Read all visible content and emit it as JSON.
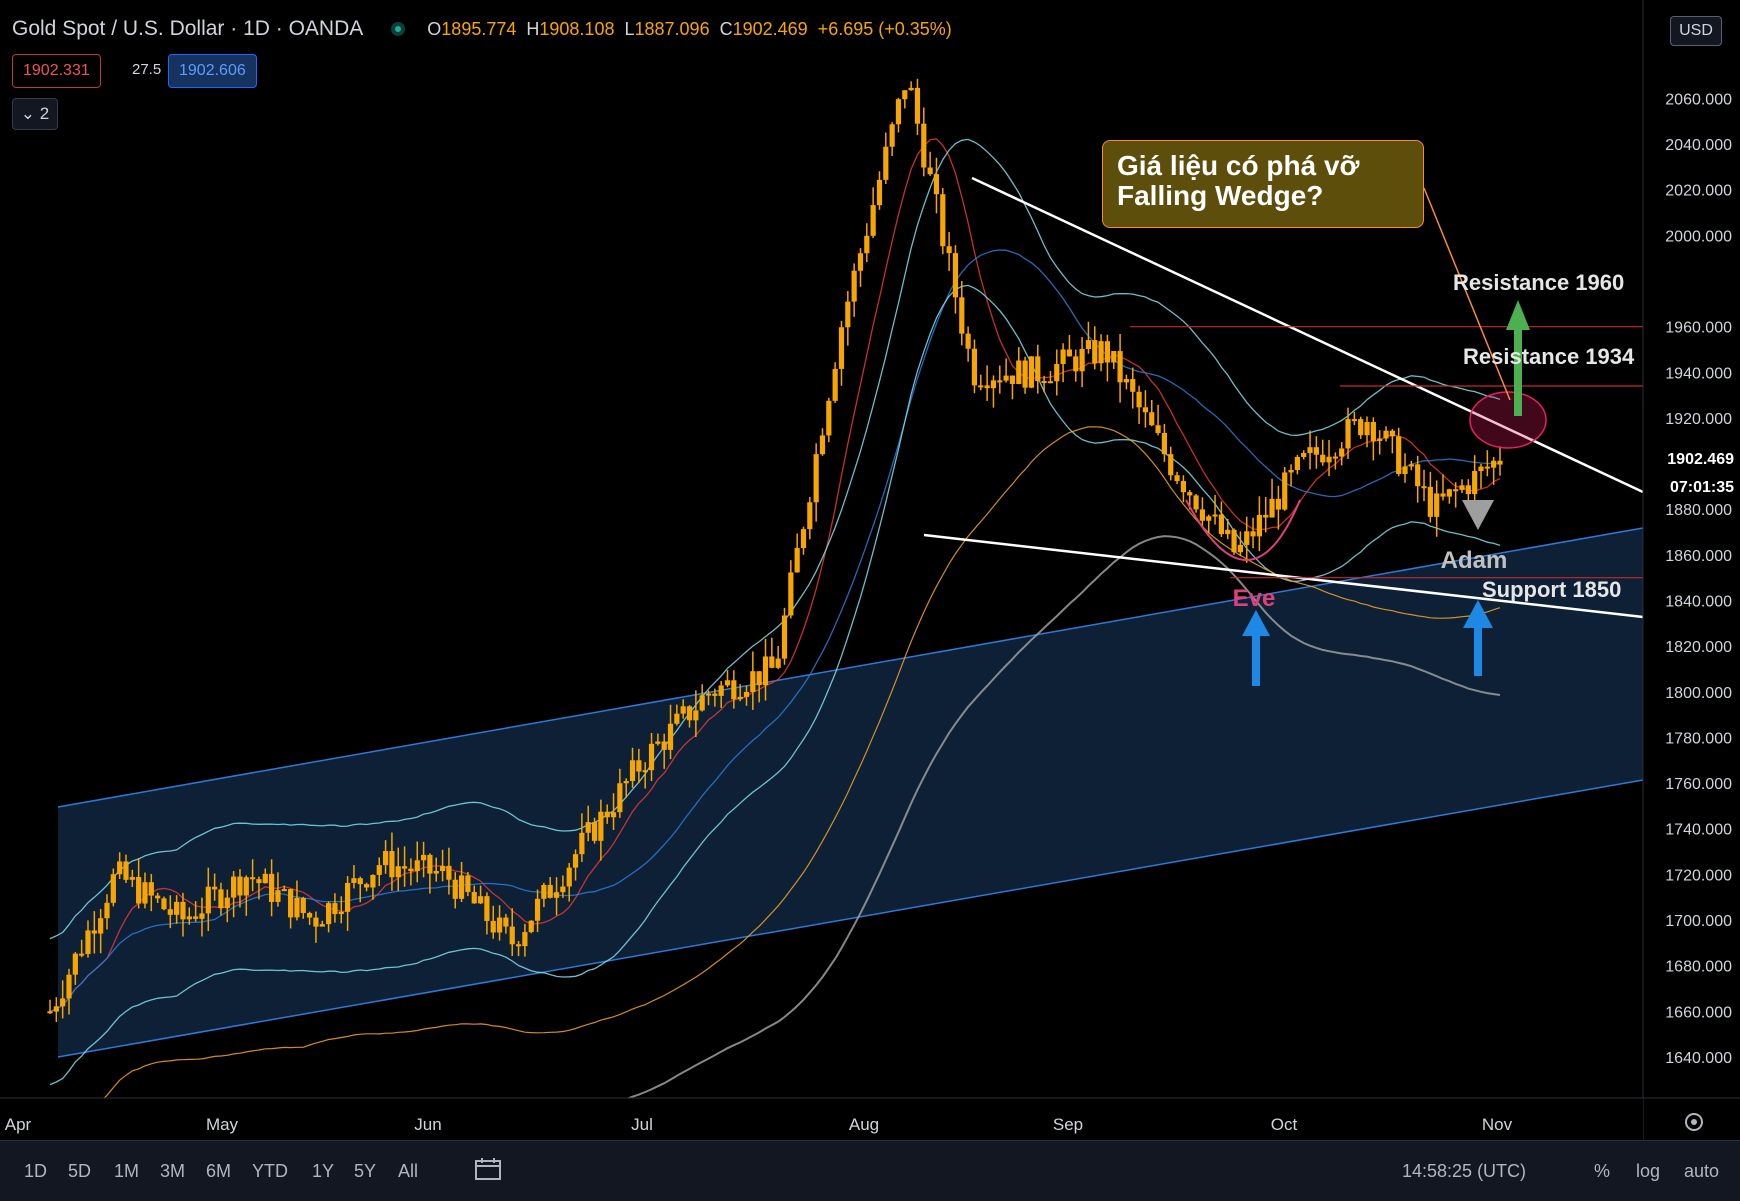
{
  "header": {
    "symbol_title": "Gold Spot / U.S. Dollar · 1D · OANDA",
    "ohlc": {
      "o_label": "O",
      "o": "1895.774",
      "h_label": "H",
      "h": "1908.108",
      "l_label": "L",
      "l": "1887.096",
      "c_label": "C",
      "c": "1902.469",
      "change": "+6.695 (+0.35%)"
    },
    "sell_price": "1902.331",
    "spread": "27.5",
    "buy_price": "1902.606",
    "indicators_button": "⌄ 2"
  },
  "price_scale": {
    "currency": "USD",
    "last_price": "1902.469",
    "countdown": "07:01:35"
  },
  "bottom_bar": {
    "ranges": [
      "1D",
      "5D",
      "1M",
      "3M",
      "6M",
      "YTD",
      "1Y",
      "5Y",
      "All"
    ],
    "time": "14:58:25 (UTC)",
    "percent": "%",
    "log": "log",
    "auto": "auto"
  },
  "annotations": {
    "callout": "Giá liệu có phá vỡ Falling Wedge?",
    "resistance_1960": "Resistance 1960",
    "resistance_1934": "Resistance 1934",
    "support_1850": "Support 1850",
    "eve": "Eve",
    "adam": "Adam"
  },
  "colors": {
    "candle": "#f7a600",
    "channel": "#2d7ad6",
    "wedge": "#ffffff",
    "eve": "#e0407a",
    "arrow_up_blue": "#1e88e5",
    "arrow_green": "#4caf50"
  },
  "chart_data": {
    "type": "candlestick",
    "symbol": "Gold Spot / U.S. Dollar",
    "interval": "1D",
    "broker": "OANDA",
    "x_tick_labels": [
      "Apr",
      "May",
      "Jun",
      "Jul",
      "Aug",
      "Sep",
      "Oct",
      "Nov"
    ],
    "y_tick_labels": [
      "1640.000",
      "1660.000",
      "1680.000",
      "1700.000",
      "1720.000",
      "1740.000",
      "1760.000",
      "1780.000",
      "1800.000",
      "1820.000",
      "1840.000",
      "1860.000",
      "1880.000",
      "1900.000",
      "1920.000",
      "1940.000",
      "1960.000",
      "2000.000",
      "2020.000",
      "2040.000",
      "2060.000"
    ],
    "ylim": [
      1622,
      2090
    ],
    "grid": false,
    "last_close": 1902.469,
    "approx_close_path": [
      {
        "x": "Apr",
        "y": 1660
      },
      {
        "x": "Apr",
        "y": 1720
      },
      {
        "x": "Apr",
        "y": 1700
      },
      {
        "x": "May",
        "y": 1720
      },
      {
        "x": "May",
        "y": 1700
      },
      {
        "x": "May",
        "y": 1725
      },
      {
        "x": "Jun",
        "y": 1720
      },
      {
        "x": "Jun",
        "y": 1690
      },
      {
        "x": "Jun",
        "y": 1730
      },
      {
        "x": "Jul",
        "y": 1770
      },
      {
        "x": "Jul",
        "y": 1800
      },
      {
        "x": "Jul",
        "y": 1810
      },
      {
        "x": "Aug",
        "y": 1960
      },
      {
        "x": "Aug",
        "y": 2070
      },
      {
        "x": "Aug",
        "y": 1940
      },
      {
        "x": "Sep",
        "y": 1940
      },
      {
        "x": "Sep",
        "y": 1950
      },
      {
        "x": "Sep",
        "y": 1900
      },
      {
        "x": "Oct",
        "y": 1860
      },
      {
        "x": "Oct",
        "y": 1900
      },
      {
        "x": "Oct",
        "y": 1920
      },
      {
        "x": "Nov",
        "y": 1880
      },
      {
        "x": "Nov",
        "y": 1902.469
      }
    ],
    "levels": [
      {
        "label": "Resistance 1960",
        "value": 1960
      },
      {
        "label": "Resistance 1934",
        "value": 1934
      },
      {
        "label": "Support 1850",
        "value": 1850
      }
    ]
  }
}
